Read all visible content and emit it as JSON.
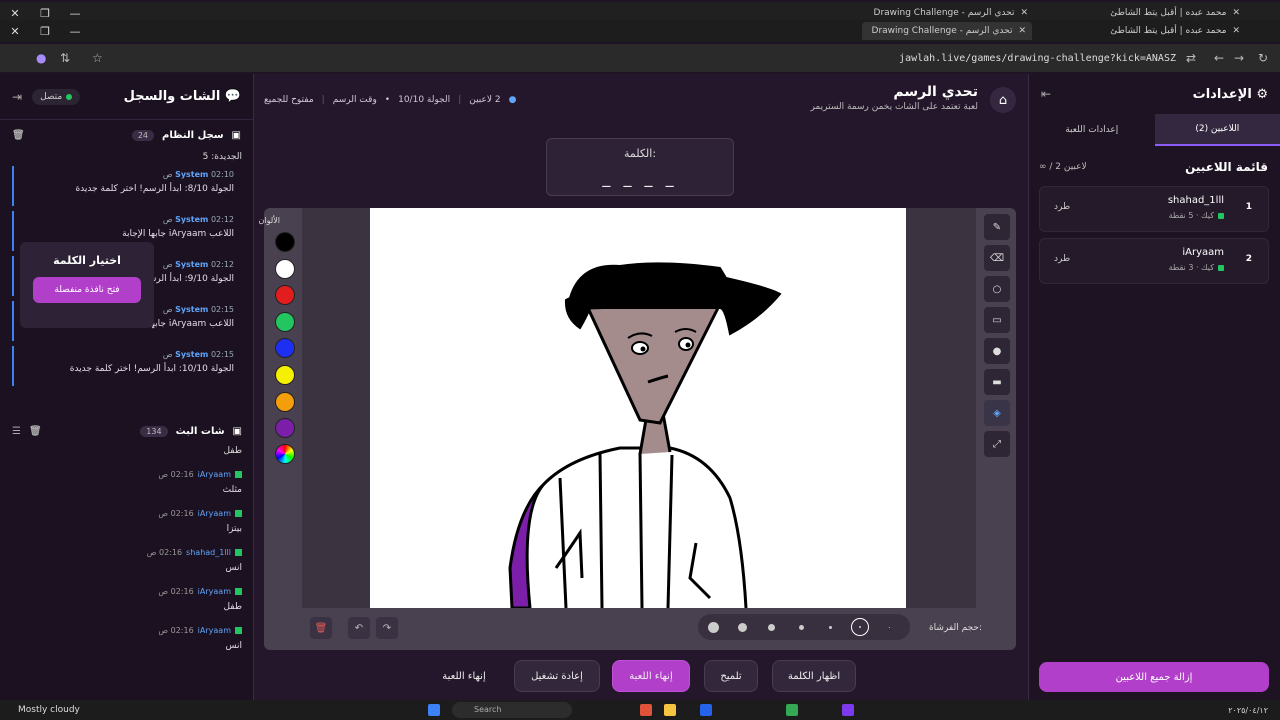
{
  "browser": {
    "tabs": [
      {
        "title": "تحدي الرسم - Drawing Challenge"
      },
      {
        "title": "محمد عبده | أقبل يتط الشاطئ"
      }
    ],
    "url": "jawlah.live/games/drawing-challenge?kick=ANASZ"
  },
  "chat_panel": {
    "title": "الشات والسجل",
    "status": "متصل",
    "system_log": {
      "title": "سجل النظام",
      "count": "24",
      "top_fragment": "الجديدة: 5",
      "entries": [
        {
          "sender": "System",
          "time": "02:10 ص",
          "text": "الجولة 8/10: ابدأ الرسم! اختر كلمة جديدة"
        },
        {
          "sender": "System",
          "time": "02:12 ص",
          "text": "اللاعب iAryaam جابها الإجابة"
        },
        {
          "sender": "System",
          "time": "02:12 ص",
          "text": "الجولة 9/10: ابدأ الرسم"
        },
        {
          "sender": "System",
          "time": "02:15 ص",
          "text": "اللاعب iAryaam جابها الإجابة: طفل - نقاطه الجديدة: 3"
        },
        {
          "sender": "System",
          "time": "02:15 ص",
          "text": "الجولة 10/10: ابدأ الرسم! اختر كلمة جديدة"
        }
      ]
    },
    "pick_word": {
      "title": "اختيار الكلمة",
      "button": "فتح نافذة منفصلة"
    },
    "live_chat": {
      "title": "شات البث",
      "count": "134",
      "top_fragment": "طفل",
      "messages": [
        {
          "user": "iAryaam",
          "time": "02:16 ص",
          "text": "مثلث"
        },
        {
          "user": "iAryaam",
          "time": "02:16 ص",
          "text": "بيتزا"
        },
        {
          "user": "shahad_1lll",
          "time": "02:16 ص",
          "text": "انس"
        },
        {
          "user": "iAryaam",
          "time": "02:16 ص",
          "text": "طفل"
        },
        {
          "user": "iAryaam",
          "time": "02:16 ص",
          "text": "انس"
        }
      ]
    }
  },
  "game": {
    "title": "تحدي الرسم",
    "subtitle": "لعبة تعتمد على الشات يخمن رسمة الستريمر",
    "status": {
      "players": "2 لاعبين",
      "round": "الجولة 10/10",
      "phase": "وقت الرسم",
      "mode": "مفتوح للجميع"
    },
    "word": {
      "label": "الكلمة:",
      "mask": "_ _ _ _"
    },
    "colors_label": "الألوان",
    "brush_label": "حجم الفرشاة:",
    "colors": [
      "#000000",
      "#ffffff",
      "#e11d1d",
      "#22c55e",
      "#1d2ff0",
      "#f5f000",
      "#f59e0b",
      "#7c1fa8"
    ],
    "actions": {
      "show_word": "اظهار الكلمة",
      "hint": "تلميح",
      "end_round": "إنهاء اللعبة",
      "restart": "إعادة تشغيل",
      "end_game": "إنهاء اللعبة"
    }
  },
  "settings": {
    "title": "الإعدادات",
    "tabs": [
      "اللاعبين (2)",
      "إعدادات اللعبة"
    ],
    "players_title": "قائمة اللاعبين",
    "players_count": "∞ / 2 لاعبين",
    "players": [
      {
        "rank": "1",
        "name": "shahad_1lll",
        "meta": "كيك · 5 نقطة",
        "kick": "طرد"
      },
      {
        "rank": "2",
        "name": "iAryaam",
        "meta": "كيك · 3 نقطة",
        "kick": "طرد"
      }
    ],
    "remove_all": "إزالة جميع اللاعبين"
  },
  "taskbar": {
    "weather": "Mostly cloudy",
    "search": "Search",
    "clock": "٢٠٢٥/٠٤/١٢"
  }
}
